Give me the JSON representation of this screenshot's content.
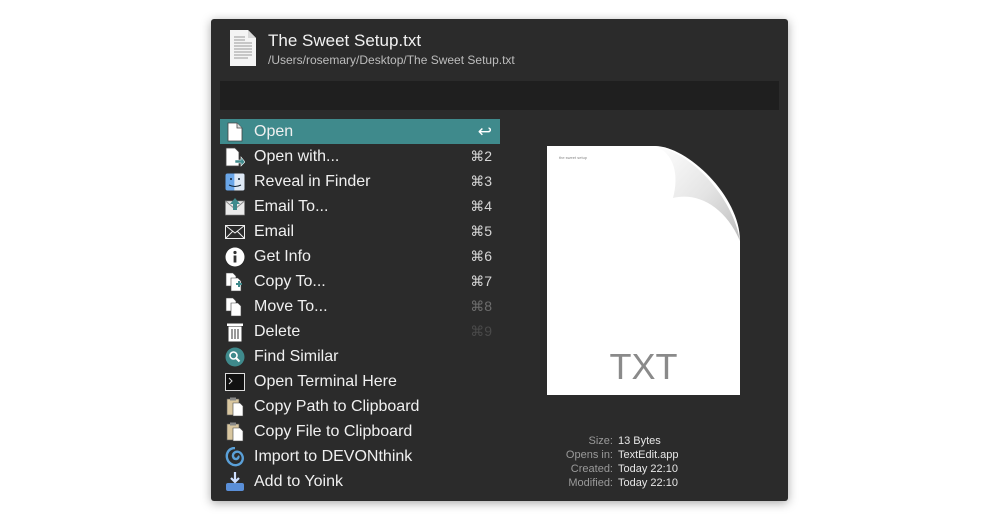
{
  "header": {
    "title": "The Sweet Setup.txt",
    "path": "/Users/rosemary/Desktop/The Sweet Setup.txt"
  },
  "search": {
    "value": "",
    "placeholder": ""
  },
  "actions": [
    {
      "label": "Open",
      "shortcut": "↩",
      "icon": "document-icon",
      "selected": true
    },
    {
      "label": "Open with...",
      "shortcut": "⌘2",
      "icon": "open-with-icon"
    },
    {
      "label": "Reveal in Finder",
      "shortcut": "⌘3",
      "icon": "finder-icon"
    },
    {
      "label": "Email To...",
      "shortcut": "⌘4",
      "icon": "email-to-icon"
    },
    {
      "label": "Email",
      "shortcut": "⌘5",
      "icon": "envelope-icon"
    },
    {
      "label": "Get Info",
      "shortcut": "⌘6",
      "icon": "info-icon"
    },
    {
      "label": "Copy To...",
      "shortcut": "⌘7",
      "icon": "copy-to-icon"
    },
    {
      "label": "Move To...",
      "shortcut": "⌘8",
      "icon": "move-to-icon"
    },
    {
      "label": "Delete",
      "shortcut": "⌘9",
      "icon": "trash-icon"
    },
    {
      "label": "Find Similar",
      "shortcut": "",
      "icon": "magnifier-icon"
    },
    {
      "label": "Open Terminal Here",
      "shortcut": "",
      "icon": "terminal-icon"
    },
    {
      "label": "Copy Path to Clipboard",
      "shortcut": "",
      "icon": "clipboard-icon"
    },
    {
      "label": "Copy File to Clipboard",
      "shortcut": "",
      "icon": "clipboard-icon"
    },
    {
      "label": "Import to DEVONthink",
      "shortcut": "",
      "icon": "devonthink-icon"
    },
    {
      "label": "Add to Yoink",
      "shortcut": "",
      "icon": "yoink-icon"
    }
  ],
  "preview": {
    "file_type": "TXT",
    "tiny_text": "the sweet setup"
  },
  "info": [
    {
      "key": "Size:",
      "value": "13 Bytes"
    },
    {
      "key": "Opens in:",
      "value": "TextEdit.app"
    },
    {
      "key": "Created:",
      "value": "Today 22:10"
    },
    {
      "key": "Modified:",
      "value": "Today 22:10"
    }
  ],
  "colors": {
    "panel": "#2b2b2b",
    "selection": "#3f8a8c",
    "search_bg": "#1f1f1f"
  }
}
